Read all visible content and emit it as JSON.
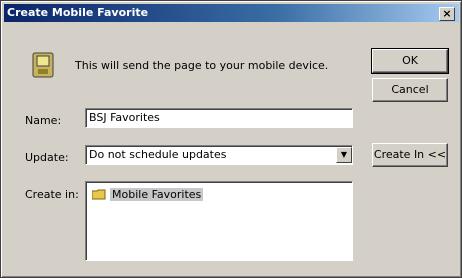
{
  "window": {
    "title": "Create Mobile Favorite",
    "close_glyph": "×"
  },
  "message": "This will send the page to your mobile device.",
  "buttons": {
    "ok": "OK",
    "cancel": "Cancel",
    "create_in": "Create In <<"
  },
  "name_field": {
    "label": "Name:",
    "value": "BSJ Favorites"
  },
  "update_field": {
    "label": "Update:",
    "value": "Do not schedule updates",
    "arrow": "▼"
  },
  "create_in": {
    "label": "Create in:",
    "items": [
      {
        "label": "Mobile Favorites",
        "icon": "folder-icon"
      }
    ]
  },
  "icons": {
    "device": "mobile-device-icon"
  },
  "colors": {
    "titlebar": "#0a246a",
    "dialog": "#d4d0c8"
  }
}
